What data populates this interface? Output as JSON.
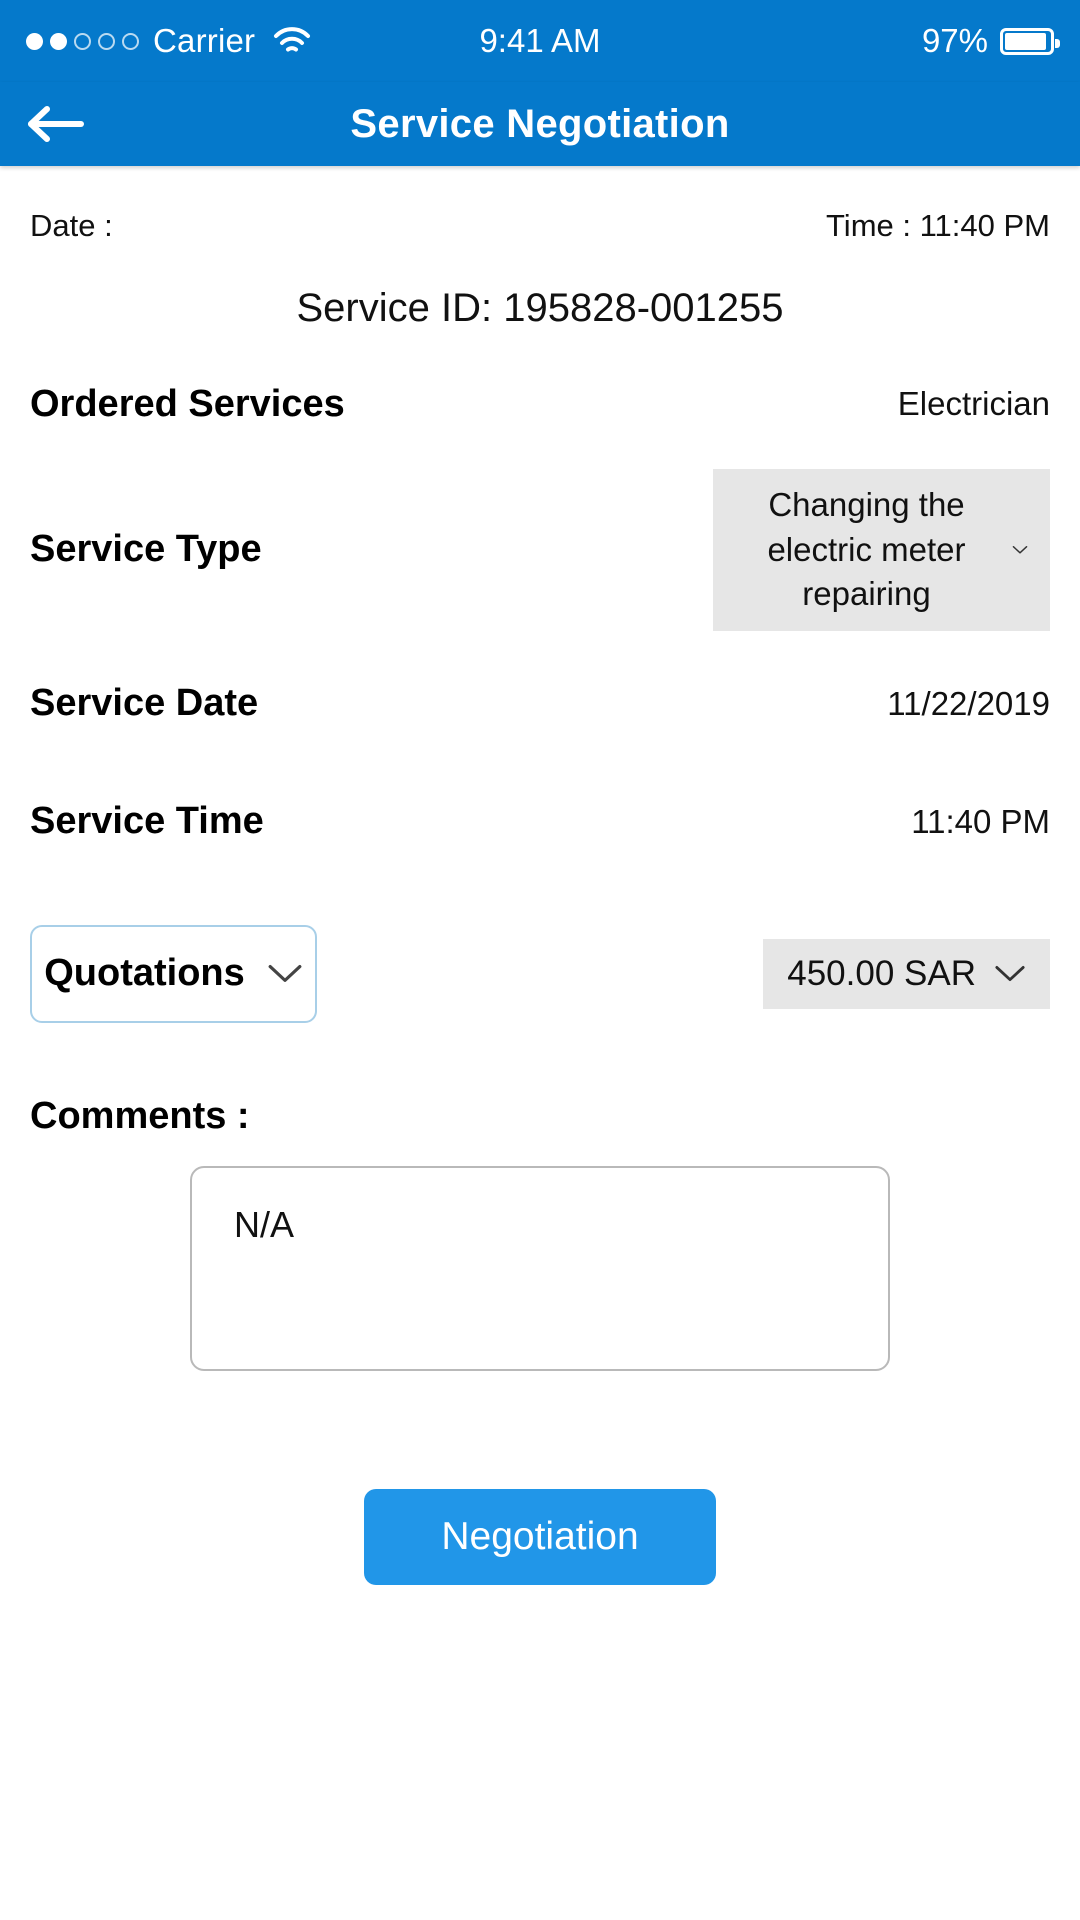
{
  "status_bar": {
    "carrier": "Carrier",
    "signal_filled": 2,
    "signal_total": 5,
    "wifi_icon": "wifi-icon",
    "time": "9:41 AM",
    "battery_percent": "97%",
    "battery_level": 93
  },
  "nav": {
    "back_icon": "arrow-left-icon",
    "title": "Service Negotiation"
  },
  "meta": {
    "date_label": "Date :",
    "date_value": "",
    "time_label": "Time :",
    "time_value": "11:40 PM"
  },
  "service_id": "Service ID: 195828-001255",
  "fields": {
    "ordered_services_label": "Ordered Services",
    "ordered_services_value": "Electrician",
    "service_type_label": "Service Type",
    "service_type_value": "Changing the electric meter repairing",
    "service_date_label": "Service Date",
    "service_date_value": "11/22/2019",
    "service_time_label": "Service Time",
    "service_time_value": "11:40 PM"
  },
  "quotations": {
    "label": "Quotations",
    "price": "450.00 SAR",
    "chevron_icon": "chevron-down-icon"
  },
  "comments": {
    "label": "Comments :",
    "value": "N/A",
    "placeholder": "N/A"
  },
  "actions": {
    "negotiation_label": "Negotiation"
  },
  "colors": {
    "header_blue": "#0579CB",
    "button_blue": "#2196E8",
    "dropdown_grey": "#e6e6e6",
    "quotation_border": "#a8cfe8"
  }
}
